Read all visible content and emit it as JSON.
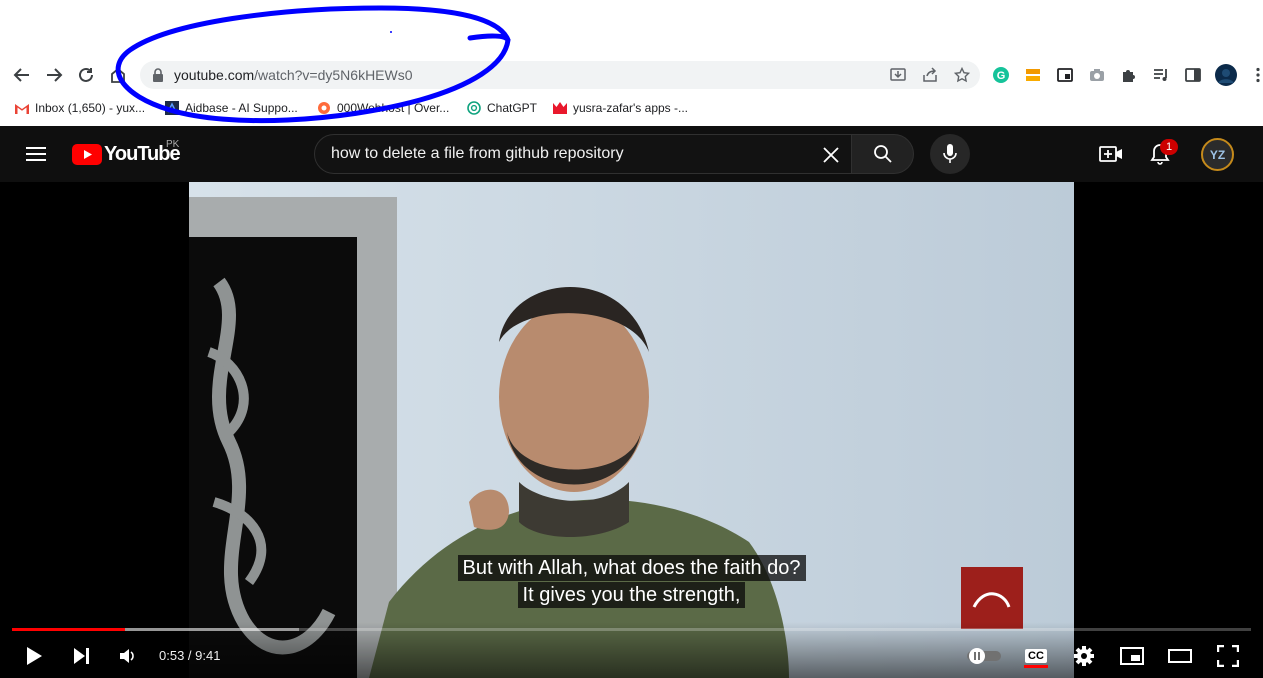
{
  "browser": {
    "url_host": "youtube.com",
    "url_rest": "/watch?v=dy5N6kHEWs0",
    "bookmarks": [
      {
        "label": "Inbox (1,650) - yux..."
      },
      {
        "label": "Aidbase - AI Suppo..."
      },
      {
        "label": "000Webhost | Over..."
      },
      {
        "label": "ChatGPT"
      },
      {
        "label": "yusra-zafar's apps -..."
      }
    ]
  },
  "youtube": {
    "logo_text": "YouTube",
    "region": "PK",
    "search_value": "how to delete a file from github repository",
    "notification_count": "1",
    "avatar_text": "YZ"
  },
  "player": {
    "caption_line1": "But with Allah, what does the faith do?",
    "caption_line2": "It gives you the strength,",
    "time_display": "0:53 / 9:41",
    "progress_played": 0.0912,
    "progress_buffered": 0.232,
    "cc_label": "CC"
  },
  "colors": {
    "youtube_red": "#ff0000",
    "annotation_blue": "#0000ff",
    "header_bg": "#0f0f0f"
  }
}
